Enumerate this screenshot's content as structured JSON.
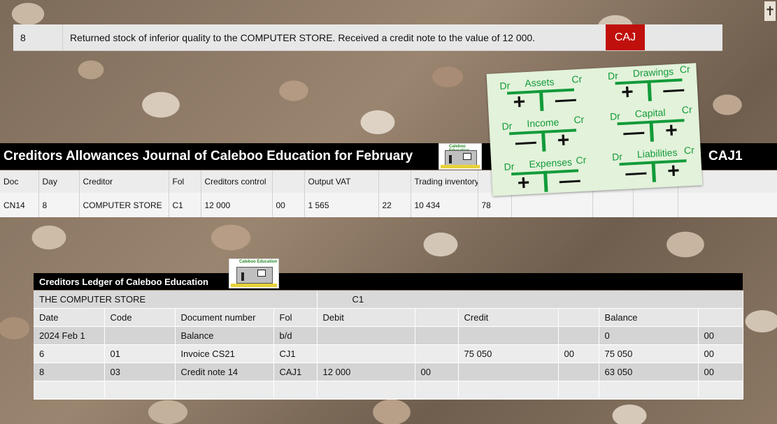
{
  "corner_icon": "cross-icon",
  "transaction": {
    "number": "8",
    "text": "Returned stock of inferior quality to the COMPUTER STORE. Received a credit note to the value of 12 000.",
    "journal_code": "CAJ"
  },
  "journal": {
    "title": "Creditors Allowances Journal of Caleboo Education for February",
    "code": "CAJ1",
    "headers": [
      "Doc",
      "Day",
      "Creditor",
      "Fol",
      "Creditors control",
      "",
      "Output VAT",
      "",
      "Trading inventory",
      "",
      "",
      "",
      "",
      ""
    ],
    "rows": [
      [
        "CN14",
        "8",
        "COMPUTER STORE",
        "C1",
        "12 000",
        "00",
        "1 565",
        "22",
        "10 434",
        "78",
        "",
        "",
        "",
        ""
      ]
    ]
  },
  "logo": {
    "text": "Caleboo Education"
  },
  "t_accounts": [
    {
      "name": "Assets",
      "dr": "Dr",
      "cr": "Cr",
      "left": "+",
      "right": "—"
    },
    {
      "name": "Drawings",
      "dr": "Dr",
      "cr": "Cr",
      "left": "+",
      "right": "—"
    },
    {
      "name": "Income",
      "dr": "Dr",
      "cr": "Cr",
      "left": "—",
      "right": "+"
    },
    {
      "name": "Capital",
      "dr": "Dr",
      "cr": "Cr",
      "left": "—",
      "right": "+"
    },
    {
      "name": "Expenses",
      "dr": "Dr",
      "cr": "Cr",
      "left": "+",
      "right": "—"
    },
    {
      "name": "Liabilities",
      "dr": "Dr",
      "cr": "Cr",
      "left": "—",
      "right": "+"
    }
  ],
  "ledger": {
    "title": "Creditors Ledger of Caleboo Education",
    "account_name": "THE COMPUTER STORE",
    "account_folio": "C1",
    "headers": [
      "Date",
      "Code",
      "Document number",
      "Fol",
      "Debit",
      "",
      "Credit",
      "",
      "Balance",
      ""
    ],
    "rows": [
      [
        "2024 Feb 1",
        "",
        "Balance",
        "b/d",
        "",
        "",
        "",
        "",
        "0",
        "00"
      ],
      [
        "6",
        "01",
        "Invoice CS21",
        "CJ1",
        "",
        "",
        "75 050",
        "00",
        "75 050",
        "00"
      ],
      [
        "8",
        "03",
        "Credit note 14",
        "CAJ1",
        "12 000",
        "00",
        "",
        "",
        "63 050",
        "00"
      ],
      [
        "",
        "",
        "",
        "",
        "",
        "",
        "",
        "",
        "",
        ""
      ]
    ]
  }
}
